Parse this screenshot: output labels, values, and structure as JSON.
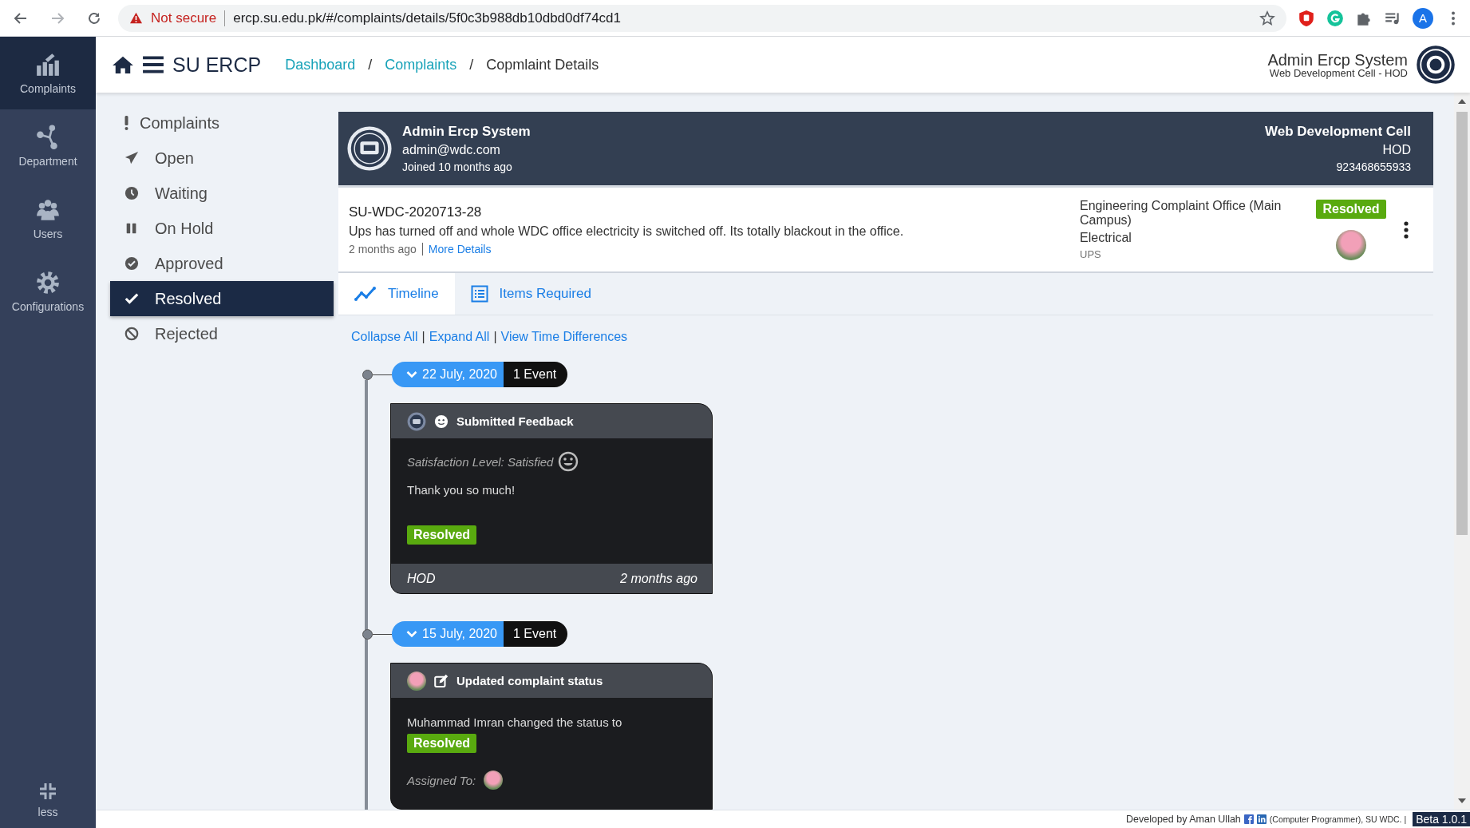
{
  "browser": {
    "security": "Not secure",
    "url": "ercp.su.edu.pk/#/complaints/details/5f0c3b988db10dbd0df74cd1",
    "profile_initial": "A"
  },
  "rail": {
    "items": [
      {
        "label": "Complaints",
        "selected": true
      },
      {
        "label": "Department",
        "selected": false
      },
      {
        "label": "Users",
        "selected": false
      },
      {
        "label": "Configurations",
        "selected": false
      }
    ],
    "collapse_label": "less"
  },
  "header": {
    "app_title": "SU ERCP",
    "breadcrumb_separator": "/",
    "breadcrumbs": [
      {
        "label": "Dashboard",
        "kind": "link"
      },
      {
        "label": "Complaints",
        "kind": "link"
      },
      {
        "label": "Copmlaint Details",
        "kind": "current"
      }
    ],
    "user_name": "Admin Ercp System",
    "user_role": "Web Development Cell - HOD"
  },
  "sidebar": {
    "items": [
      {
        "label": "Complaints",
        "kind": "heading",
        "selected": false
      },
      {
        "label": "Open",
        "kind": "item",
        "selected": false
      },
      {
        "label": "Waiting",
        "kind": "item",
        "selected": false
      },
      {
        "label": "On Hold",
        "kind": "item",
        "selected": false
      },
      {
        "label": "Approved",
        "kind": "item",
        "selected": false
      },
      {
        "label": "Resolved",
        "kind": "item",
        "selected": true
      },
      {
        "label": "Rejected",
        "kind": "item",
        "selected": false
      }
    ]
  },
  "profile": {
    "name": "Admin Ercp System",
    "email": "admin@wdc.com",
    "joined": "Joined 10 months ago",
    "department": "Web Development Cell",
    "role": "HOD",
    "phone": "923468655933"
  },
  "complaint": {
    "code": "SU-WDC-2020713-28",
    "description": "Ups has turned off and whole WDC office electricity is switched off. Its totally blackout in the office.",
    "time": "2 months ago",
    "more_link": "More Details",
    "office": "Engineering Complaint Office (Main Campus)",
    "category": "Electrical",
    "subcategory": "UPS",
    "status": "Resolved"
  },
  "tabs": [
    {
      "label": "Timeline",
      "selected": true
    },
    {
      "label": "Items Required",
      "selected": false
    }
  ],
  "timeline_links": [
    "Collapse All",
    "Expand All",
    "View Time Differences"
  ],
  "timeline_link_separator": "|",
  "timeline": [
    {
      "date": "22 July, 2020",
      "count": "1 Event",
      "expanded": true,
      "event": {
        "kind": "feedback",
        "title": "Submitted Feedback",
        "satisfaction": "Satisfaction Level: Satisfied",
        "message": "Thank you so much!",
        "status": "Resolved",
        "role": "HOD",
        "time": "2 months ago"
      }
    },
    {
      "date": "15 July, 2020",
      "count": "1 Event",
      "expanded": true,
      "event": {
        "kind": "status",
        "title": "Updated complaint status",
        "message": "Muhammad Imran changed the status to",
        "status": "Resolved",
        "assigned_label": "Assigned To:"
      }
    }
  ],
  "footer": {
    "credit": "Developed by Aman Ullah",
    "credit_role": "(Computer Programmer), SU WDC. |",
    "version": "Beta 1.0.1"
  }
}
